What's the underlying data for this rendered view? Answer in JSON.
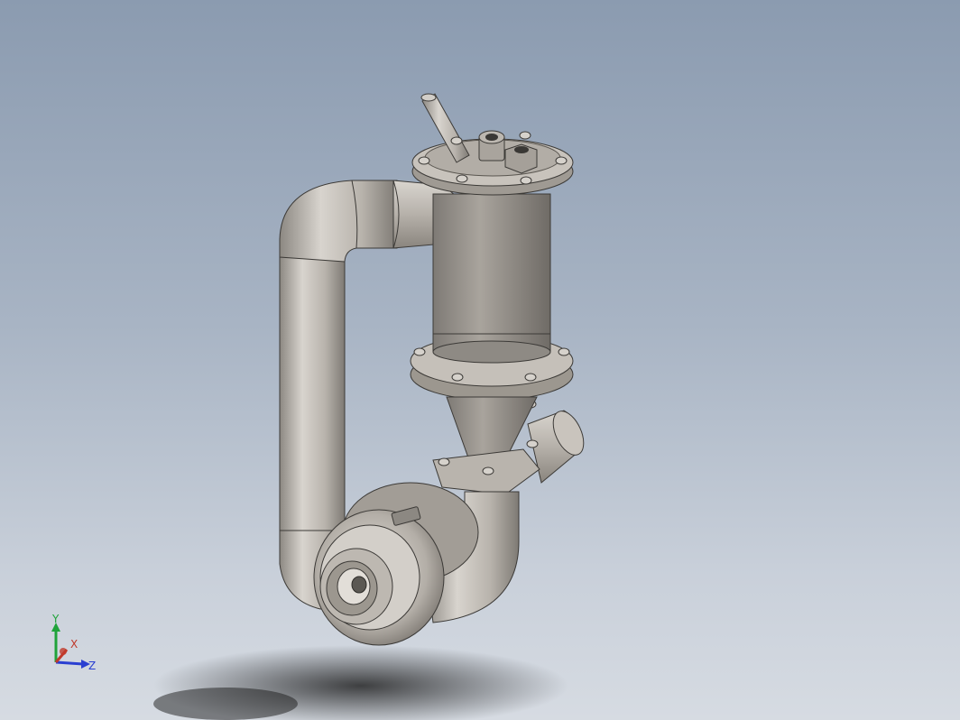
{
  "viewport": {
    "background_top": "#8b9bb0",
    "background_bottom": "#d6dbe2",
    "model_color": "#b5b0aa"
  },
  "triad": {
    "y_label": "Y",
    "x_label": "X",
    "z_label": "Z",
    "y_color": "#1fa33a",
    "x_color": "#c0392b",
    "z_color": "#2a3fd1"
  }
}
